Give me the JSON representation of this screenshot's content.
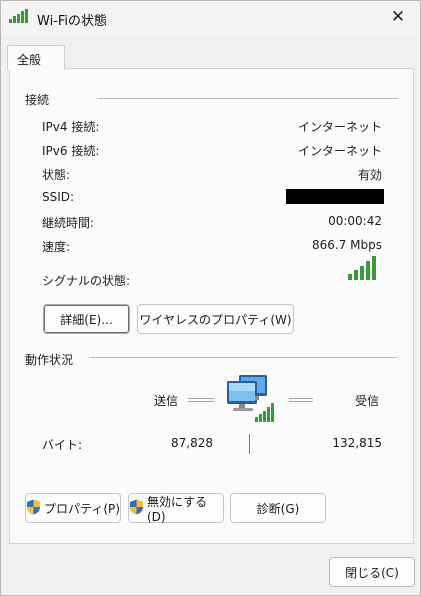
{
  "window": {
    "title": "Wi-Fiの状態",
    "close_symbol": "✕"
  },
  "tabs": [
    {
      "label": "全般"
    }
  ],
  "connection": {
    "heading": "接続",
    "rows": [
      {
        "label": "IPv4 接続:",
        "value": "インターネット"
      },
      {
        "label": "IPv6 接続:",
        "value": "インターネット"
      },
      {
        "label": "状態:",
        "value": "有効"
      },
      {
        "label": "SSID:",
        "value": ""
      },
      {
        "label": "継続時間:",
        "value": "00:00:42"
      },
      {
        "label": "速度:",
        "value": "866.7 Mbps"
      }
    ],
    "signal_label": "シグナルの状態:",
    "signal_bars": 5,
    "signal_color": "#3a9a3a"
  },
  "buttons": {
    "details": "詳細(E)...",
    "wireless_properties": "ワイヤレスのプロパティ(W)",
    "properties": "プロパティ(P)",
    "disable": "無効にする(D)",
    "diagnose": "診断(G)",
    "close": "閉じる(C)"
  },
  "activity": {
    "heading": "動作状況",
    "sent_label": "送信",
    "received_label": "受信",
    "bytes_label": "バイト:",
    "bytes_sent": "87,828",
    "bytes_received": "132,815"
  },
  "icons": {
    "title": "wifi-signal-icon",
    "network": "network-computers-icon",
    "shield": "uac-shield-icon"
  },
  "colors": {
    "shield_blue": "#2f6fc4",
    "shield_yellow": "#f2c12e"
  }
}
